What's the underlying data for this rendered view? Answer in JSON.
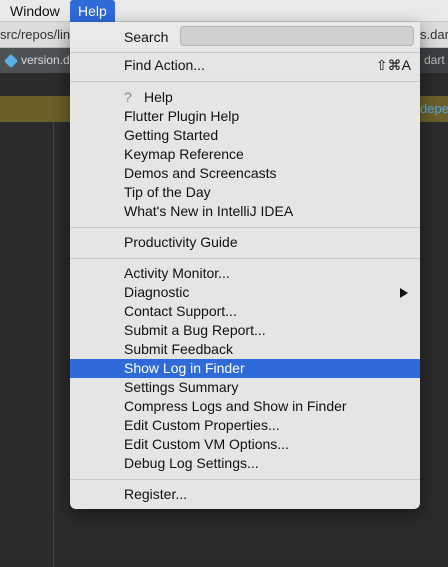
{
  "menubar": {
    "window": "Window",
    "help": "Help"
  },
  "ide": {
    "path_left": "src/repos/lin",
    "path_right": "s.dart",
    "tab_file": "version.dart",
    "tab_right": "dart",
    "banner_text": "depe"
  },
  "menu": {
    "search_label": "Search",
    "search_value": "",
    "find_action": "Find Action...",
    "find_action_shortcut": "⇧⌘A",
    "help_glyph": "?",
    "help": "Help",
    "flutter_help": "Flutter Plugin Help",
    "getting_started": "Getting Started",
    "keymap_reference": "Keymap Reference",
    "demos": "Demos and Screencasts",
    "tip_of_day": "Tip of the Day",
    "whats_new": "What's New in IntelliJ IDEA",
    "productivity_guide": "Productivity Guide",
    "activity_monitor": "Activity Monitor...",
    "diagnostic": "Diagnostic",
    "contact_support": "Contact Support...",
    "submit_bug": "Submit a Bug Report...",
    "submit_feedback": "Submit Feedback",
    "show_log": "Show Log in Finder",
    "settings_summary": "Settings Summary",
    "compress_logs": "Compress Logs and Show in Finder",
    "edit_properties": "Edit Custom Properties...",
    "edit_vm_options": "Edit Custom VM Options...",
    "debug_log_settings": "Debug Log Settings...",
    "register": "Register..."
  },
  "colors": {
    "highlight": "#2f6ad9",
    "menu_bg": "#e9e9e9",
    "ide_bg": "#2b2b2b"
  }
}
